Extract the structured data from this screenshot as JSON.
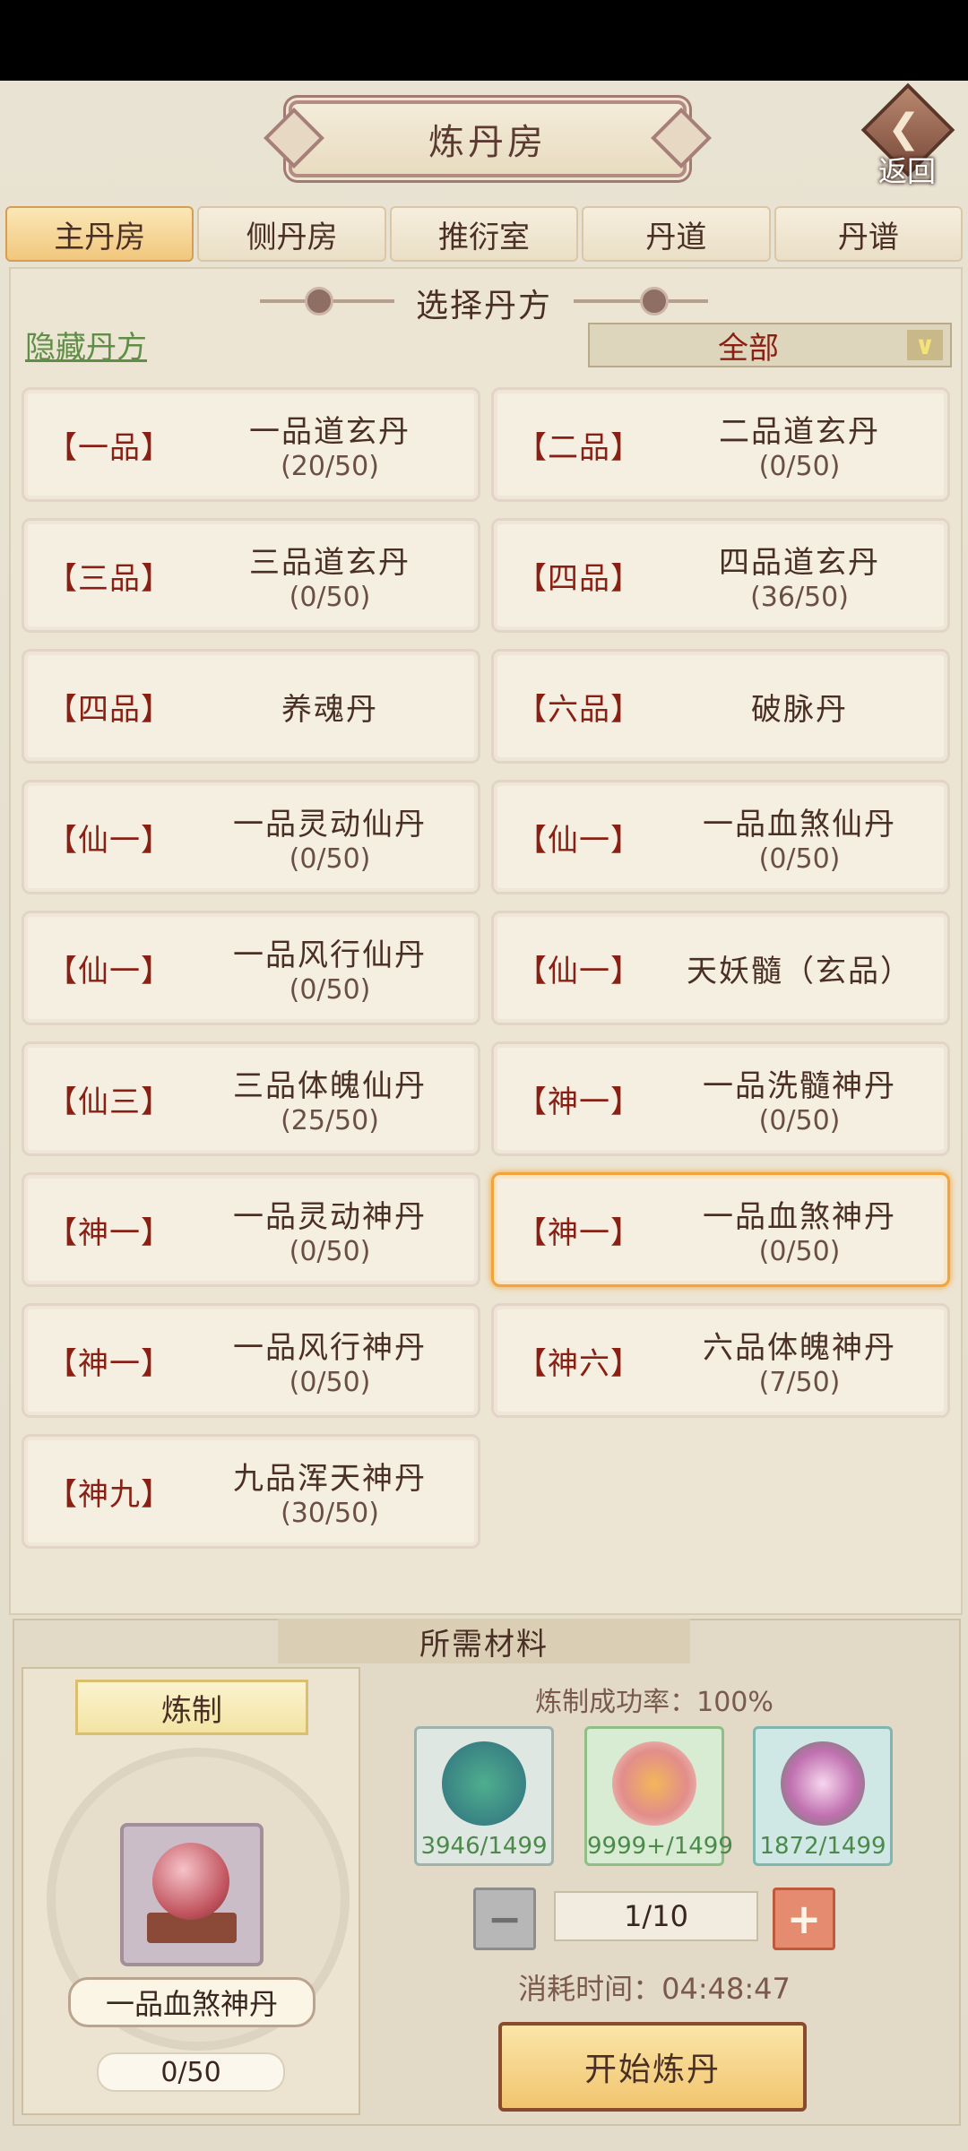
{
  "header": {
    "title": "炼丹房",
    "back_label": "返回"
  },
  "tabs": [
    "主丹房",
    "侧丹房",
    "推衍室",
    "丹道",
    "丹谱"
  ],
  "section_title": "选择丹方",
  "hide_link": "隐藏丹方",
  "filter_value": "全部",
  "recipes": [
    {
      "grade": "【一品】",
      "name": "一品道玄丹",
      "count": "(20/50)"
    },
    {
      "grade": "【二品】",
      "name": "二品道玄丹",
      "count": "(0/50)"
    },
    {
      "grade": "【三品】",
      "name": "三品道玄丹",
      "count": "(0/50)"
    },
    {
      "grade": "【四品】",
      "name": "四品道玄丹",
      "count": "(36/50)"
    },
    {
      "grade": "【四品】",
      "name": "养魂丹",
      "count": ""
    },
    {
      "grade": "【六品】",
      "name": "破脉丹",
      "count": ""
    },
    {
      "grade": "【仙一】",
      "name": "一品灵动仙丹",
      "count": "(0/50)"
    },
    {
      "grade": "【仙一】",
      "name": "一品血煞仙丹",
      "count": "(0/50)"
    },
    {
      "grade": "【仙一】",
      "name": "一品风行仙丹",
      "count": "(0/50)"
    },
    {
      "grade": "【仙一】",
      "name": "天妖髓（玄品）",
      "count": ""
    },
    {
      "grade": "【仙三】",
      "name": "三品体魄仙丹",
      "count": "(25/50)"
    },
    {
      "grade": "【神一】",
      "name": "一品洗髓神丹",
      "count": "(0/50)"
    },
    {
      "grade": "【神一】",
      "name": "一品灵动神丹",
      "count": "(0/50)"
    },
    {
      "grade": "【神一】",
      "name": "一品血煞神丹",
      "count": "(0/50)"
    },
    {
      "grade": "【神一】",
      "name": "一品风行神丹",
      "count": "(0/50)"
    },
    {
      "grade": "【神六】",
      "name": "六品体魄神丹",
      "count": "(7/50)"
    },
    {
      "grade": "【神九】",
      "name": "九品浑天神丹",
      "count": "(30/50)"
    }
  ],
  "materials_title": "所需材料",
  "craft_label": "炼制",
  "selected_pill": {
    "name": "一品血煞神丹",
    "count": "0/50"
  },
  "success_rate": "炼制成功率：100%",
  "materials": [
    {
      "name": "tree-herb-icon",
      "count": "3946/1499"
    },
    {
      "name": "lotus-flower-icon",
      "count": "9999+/1499"
    },
    {
      "name": "pink-flower-icon",
      "count": "1872/1499"
    }
  ],
  "quantity": "1/10",
  "time_text": "消耗时间：04:48:47",
  "start_button": "开始炼丹"
}
